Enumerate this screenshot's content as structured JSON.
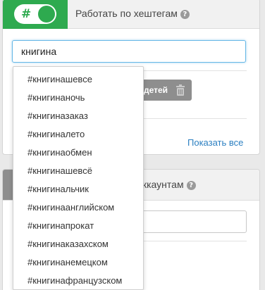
{
  "hashtag_panel": {
    "toggle_icon": "#",
    "toggle_state": "on",
    "title": "Работать по хештегам",
    "help_icon": "?",
    "search_value": "книгина",
    "gray_button_label": "детей",
    "show_all_label": "Показать все"
  },
  "suggestions": [
    "#книгинашевсе",
    "#книгинаночь",
    "#книгиназаказ",
    "#книгиналето",
    "#книгинаобмен",
    "#книгинашевсё",
    "#книгинальчик",
    "#книгинаанглийском",
    "#книгинапрокат",
    "#книгинаказахском",
    "#книгинанемецком",
    "#книгинафранцузском"
  ],
  "accounts_panel": {
    "title_visible": "ккаунтам",
    "help_icon": "?"
  },
  "colors": {
    "accent_green": "#2eaa4f",
    "link_blue": "#2b7fc1",
    "input_focus": "#66b7e6"
  }
}
